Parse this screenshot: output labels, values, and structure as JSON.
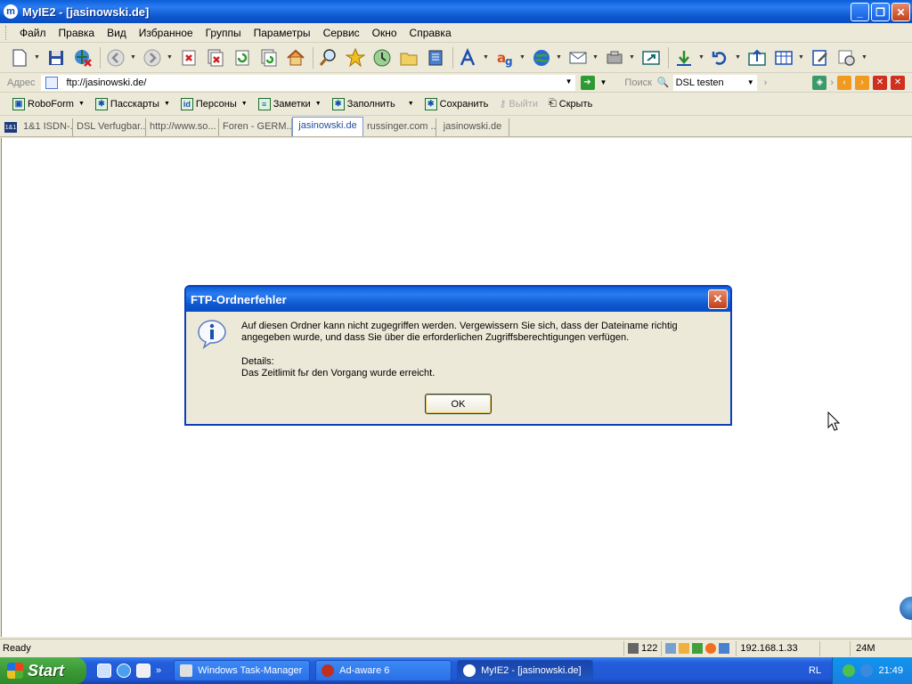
{
  "window": {
    "title": "MyIE2 - [jasinowski.de]",
    "app_icon": "myie2-icon",
    "controls": {
      "minimize": "_",
      "restore": "❐",
      "close": "✕"
    }
  },
  "menu": [
    "Файл",
    "Правка",
    "Вид",
    "Избранное",
    "Группы",
    "Параметры",
    "Сервис",
    "Окно",
    "Справка"
  ],
  "address": {
    "label": "Адрес",
    "value": "ftp://jasinowski.de/",
    "search_label": "Поиск",
    "search_value": "DSL testen"
  },
  "roboform": {
    "items": [
      {
        "label": "RoboForm",
        "icon": "robo"
      },
      {
        "label": "Пасскарты",
        "icon": "✱"
      },
      {
        "label": "Персоны",
        "icon": "ID"
      },
      {
        "label": "Заметки",
        "icon": "≡"
      },
      {
        "label": "Заполнить",
        "icon": "✱"
      },
      {
        "label": "Сохранить",
        "icon": "✱"
      },
      {
        "label": "Выйти",
        "icon": "key",
        "disabled": true
      },
      {
        "label": "Скрыть",
        "icon": "hide"
      }
    ]
  },
  "tabs": [
    {
      "label": "1&1 ISDN-...",
      "active": false
    },
    {
      "label": "DSL Verfugbar...",
      "active": false
    },
    {
      "label": "http://www.so...",
      "active": false
    },
    {
      "label": "Foren - GERM...",
      "active": false
    },
    {
      "label": "jasinowski.de",
      "active": true
    },
    {
      "label": "russinger.com ...",
      "active": false
    },
    {
      "label": "jasinowski.de",
      "active": false
    }
  ],
  "dialog": {
    "title": "FTP-Ordnerfehler",
    "message": "Auf diesen Ordner kann nicht zugegriffen werden. Vergewissern Sie sich, dass der Dateiname richtig angegeben wurde, und dass Sie über die erforderlichen Zugriffsberechtigungen verfügen.",
    "details_label": "Details:",
    "details_text": "Das Zeitlimit fьr den Vorgang wurde erreicht.",
    "ok_label": "OK",
    "icon": "info-icon"
  },
  "status": {
    "text": "Ready",
    "count": "122",
    "ip": "192.168.1.33",
    "memory": "24M"
  },
  "taskbar": {
    "start_label": "Start",
    "tasks": [
      {
        "label": "Windows Task-Manager",
        "active": false
      },
      {
        "label": "Ad-aware 6",
        "active": false
      },
      {
        "label": "MyIE2 - [jasinowski.de]",
        "active": true
      }
    ],
    "language": "RL",
    "clock": "21:49"
  },
  "colors": {
    "titlebar_blue": "#0a5fd8",
    "chrome": "#ece9d8",
    "start_green": "#3c9a36"
  }
}
